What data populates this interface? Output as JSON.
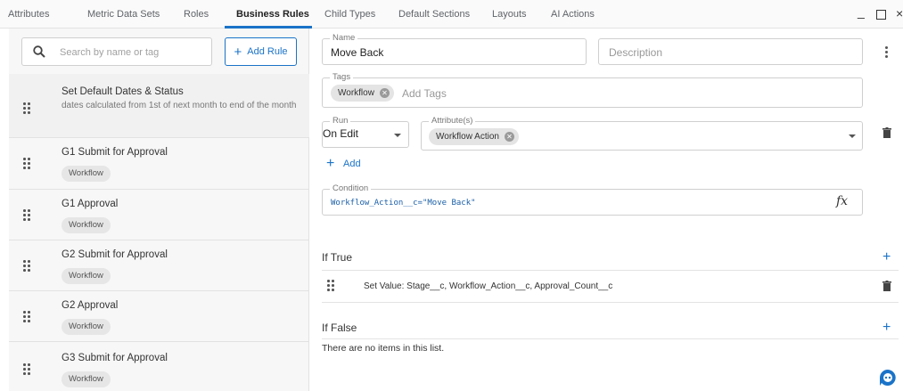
{
  "tabs": [
    {
      "label": "Attributes"
    },
    {
      "label": "Metric Data Sets"
    },
    {
      "label": "Roles"
    },
    {
      "label": "Business Rules",
      "active": true
    },
    {
      "label": "Child Types"
    },
    {
      "label": "Default Sections"
    },
    {
      "label": "Layouts"
    },
    {
      "label": "AI Actions"
    }
  ],
  "window": {
    "minimize": "_",
    "close": "×"
  },
  "left": {
    "search_placeholder": "Search by name or tag",
    "add_rule_label": "Add Rule",
    "rules": [
      {
        "title": "Set Default Dates & Status",
        "description": "dates calculated from 1st of next month to end of the month"
      },
      {
        "title": "G1 Submit for Approval",
        "tag": "Workflow"
      },
      {
        "title": "G1 Approval",
        "tag": "Workflow"
      },
      {
        "title": "G2 Submit for Approval",
        "tag": "Workflow"
      },
      {
        "title": "G2 Approval",
        "tag": "Workflow"
      },
      {
        "title": "G3 Submit for Approval",
        "tag": "Workflow"
      }
    ]
  },
  "detail": {
    "name_legend": "Name",
    "name_value": "Move Back",
    "description_placeholder": "Description",
    "tags_legend": "Tags",
    "tag_chip": "Workflow",
    "tags_placeholder": "Add Tags",
    "run_legend": "Run",
    "run_value": "On Edit",
    "attributes_legend": "Attribute(s)",
    "attribute_chip": "Workflow Action",
    "add_label": "Add",
    "condition_legend": "Condition",
    "condition_value": "Workflow_Action__c=\"Move Back\"",
    "fx_label": "fx",
    "if_true_label": "If True",
    "if_true_item": "Set Value: Stage__c, Workflow_Action__c, Approval_Count__c",
    "if_false_label": "If False",
    "if_false_empty": "There are no items in this list."
  },
  "colors": {
    "accent": "#1a73c8"
  }
}
